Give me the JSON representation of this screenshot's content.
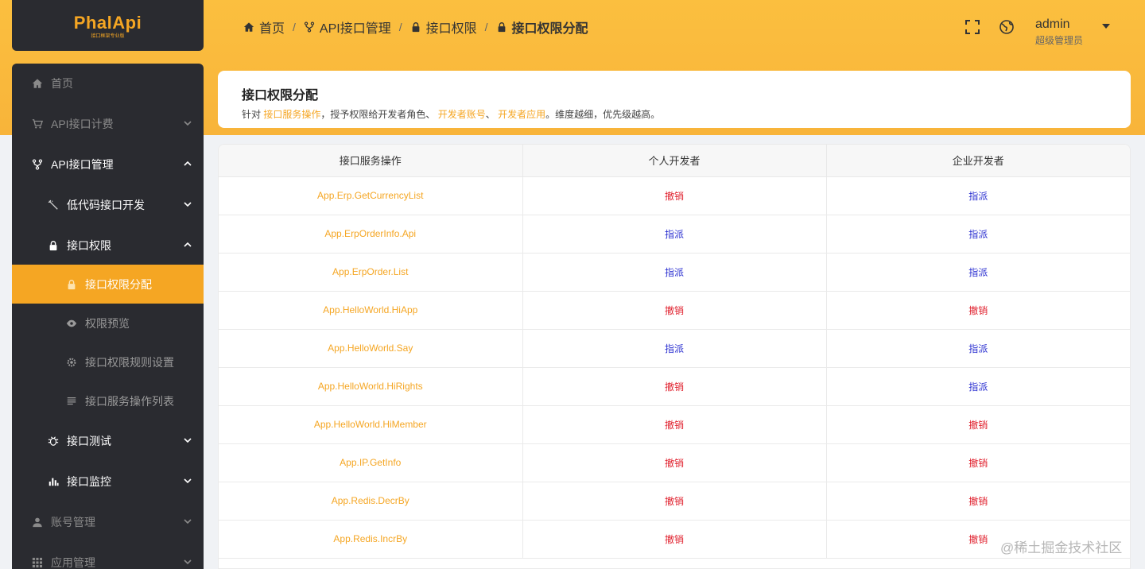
{
  "logo": {
    "text": "PhalApi",
    "subtitle": "接口框架专业版"
  },
  "breadcrumb": [
    {
      "label": "首页",
      "icon": "home-icon"
    },
    {
      "label": "API接口管理",
      "icon": "branch-icon"
    },
    {
      "label": "接口权限",
      "icon": "lock-icon"
    },
    {
      "label": "接口权限分配",
      "icon": "lock-icon"
    }
  ],
  "breadcrumb_sep": "/",
  "user": {
    "name": "admin",
    "role": "超级管理员"
  },
  "sidebar": {
    "items": [
      {
        "label": "首页",
        "icon": "home-icon"
      },
      {
        "label": "API接口计费",
        "icon": "cart-icon"
      },
      {
        "label": "API接口管理",
        "icon": "branch-icon"
      },
      {
        "label": "低代码接口开发",
        "icon": "wand-icon"
      },
      {
        "label": "接口权限",
        "icon": "lock-icon"
      },
      {
        "label": "接口权限分配",
        "icon": "lock-icon"
      },
      {
        "label": "权限预览",
        "icon": "eye-icon"
      },
      {
        "label": "接口权限规则设置",
        "icon": "gear-icon"
      },
      {
        "label": "接口服务操作列表",
        "icon": "list-icon"
      },
      {
        "label": "接口测试",
        "icon": "bug-icon"
      },
      {
        "label": "接口监控",
        "icon": "bar-chart-icon"
      },
      {
        "label": "账号管理",
        "icon": "user-icon"
      },
      {
        "label": "应用管理",
        "icon": "grid-icon"
      }
    ]
  },
  "info": {
    "title": "接口权限分配",
    "desc_prefix": "针对 ",
    "link1": "接口服务操作",
    "desc_mid1": "，授予权限给开发者角色、 ",
    "link2": "开发者账号",
    "desc_mid2": "、 ",
    "link3": "开发者应用",
    "desc_suffix": "。维度越细，优先级越高。"
  },
  "table": {
    "headers": [
      "接口服务操作",
      "个人开发者",
      "企业开发者"
    ],
    "rows": [
      [
        "App.Erp.GetCurrencyList",
        "撤销",
        "指派"
      ],
      [
        "App.ErpOrderInfo.Api",
        "指派",
        "指派"
      ],
      [
        "App.ErpOrder.List",
        "指派",
        "指派"
      ],
      [
        "App.HelloWorld.HiApp",
        "撤销",
        "撤销"
      ],
      [
        "App.HelloWorld.Say",
        "指派",
        "指派"
      ],
      [
        "App.HelloWorld.HiRights",
        "撤销",
        "指派"
      ],
      [
        "App.HelloWorld.HiMember",
        "撤销",
        "撤销"
      ],
      [
        "App.IP.GetInfo",
        "撤销",
        "撤销"
      ],
      [
        "App.Redis.DecrBy",
        "撤销",
        "撤销"
      ],
      [
        "App.Redis.IncrBy",
        "撤销",
        "撤销"
      ]
    ]
  },
  "watermark": "@稀土掘金技术社区",
  "colors": {
    "accent": "#f5a623",
    "revoke": "#e0212e",
    "assign": "#2a2fd0",
    "sidebar": "#2a2b30"
  }
}
